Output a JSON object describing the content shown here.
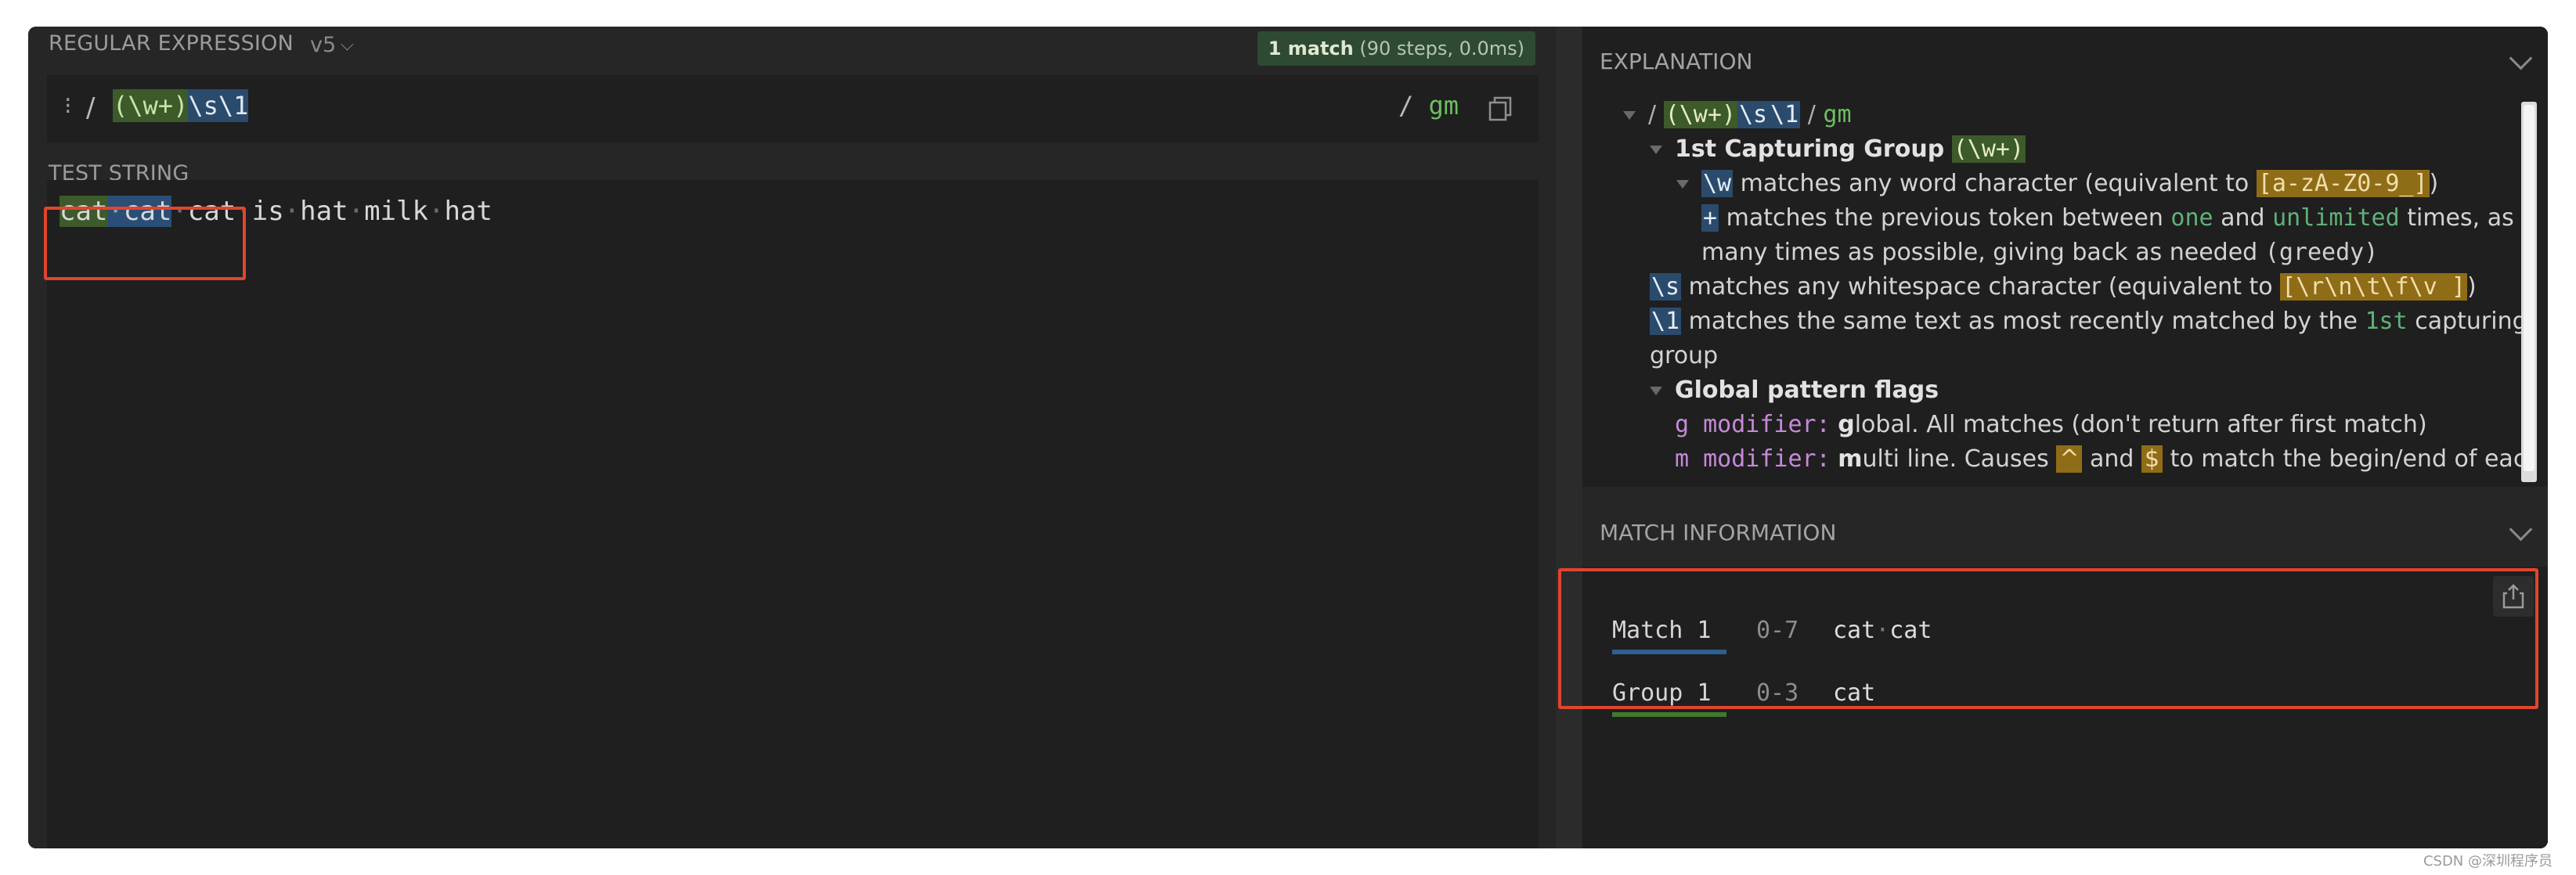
{
  "left": {
    "regex_header": "REGULAR EXPRESSION",
    "version": "v5",
    "match_badge": {
      "count": "1 match",
      "detail": "(90 steps, 0.0ms)"
    },
    "delimiter_open": "/",
    "regex_tokens": {
      "group": "(\\w+)",
      "space": "\\s",
      "backref": "\\1"
    },
    "delimiter_close": "/",
    "flags": "gm",
    "test_header": "TEST STRING",
    "test_string": {
      "m_group": "cat",
      "m_sep": "·",
      "m_second": "cat",
      "rest1": "cat",
      "rest2": "is",
      "rest3": "hat",
      "rest4": "milk",
      "rest5": "hat"
    }
  },
  "explanation": {
    "header": "EXPLANATION",
    "root": {
      "slash": "/",
      "group": "(\\w+)",
      "space": "\\s",
      "backref": "\\1",
      "slash2": "/",
      "flags": "gm"
    },
    "group1_title": "1st Capturing Group",
    "group1_token": "(\\w+)",
    "w_token": "\\w",
    "w_text": "matches any word character (equivalent to",
    "w_class": "[a-zA-Z0-9_]",
    "w_close": ")",
    "plus_token": "+",
    "plus_text1": "matches the previous token between",
    "plus_one": "one",
    "plus_and": "and",
    "plus_unlimited": "unlimited",
    "plus_times": "times, as",
    "plus_text2": "many times as possible, giving back as needed",
    "plus_greedy": "(greedy)",
    "s_token": "\\s",
    "s_text": "matches any whitespace character (equivalent to",
    "s_class": "[\\r\\n\\t\\f\\v ]",
    "s_close": ")",
    "b_token": "\\1",
    "b_text": "matches the same text as most recently matched by the",
    "b_first": "1st",
    "b_capturing": "capturing",
    "b_group": "group",
    "flags_title": "Global pattern flags",
    "g_mod": "g modifier:",
    "g_letter": "g",
    "g_text": "lobal. All matches (don't return after first match)",
    "m_mod": "m modifier:",
    "m_letter": "m",
    "m_text1": "ulti line. Causes",
    "m_caret": "^",
    "m_and": "and",
    "m_dollar": "$",
    "m_text2": "to match the begin/end of each"
  },
  "match_info": {
    "header": "MATCH INFORMATION",
    "rows": [
      {
        "label": "Match 1",
        "range": "0-7",
        "value_a": "cat",
        "value_sep": "·",
        "value_b": "cat"
      },
      {
        "label": "Group 1",
        "range": "0-3",
        "value": "cat"
      }
    ]
  },
  "watermark": "CSDN @深圳程序员",
  "colors": {
    "accent_match": "#2a4e76",
    "accent_group": "#3d5a2a",
    "annotation_red": "#e0452e",
    "flag_green": "#6dbf60"
  }
}
